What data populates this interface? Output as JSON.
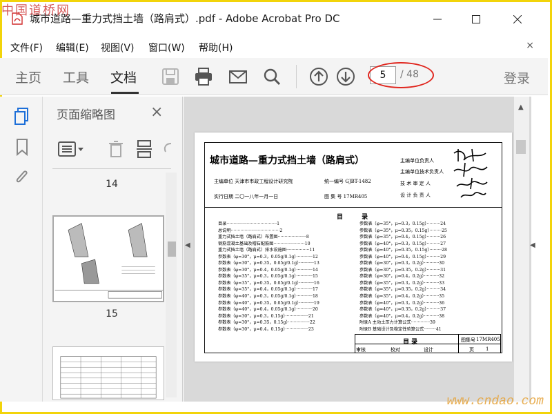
{
  "watermark_top": "中国道桥网",
  "watermark_bottom": "www.cndao.com",
  "window": {
    "title": "城市道路—重力式挡土墙（路肩式）.pdf - Adobe Acrobat Pro DC",
    "minimize_icon": "minimize-icon",
    "maximize_icon": "maximize-icon",
    "close_icon": "close-icon"
  },
  "menubar": {
    "items": [
      "文件(F)",
      "编辑(E)",
      "视图(V)",
      "窗口(W)",
      "帮助(H)"
    ],
    "close": "×"
  },
  "toolbar": {
    "tabs": [
      "主页",
      "工具",
      "文档"
    ],
    "active_tab": "文档",
    "icons": [
      "save-icon",
      "print-icon",
      "email-icon",
      "search-icon",
      "page-up-icon",
      "page-down-icon"
    ],
    "page_current": "5",
    "page_total": "/ 48",
    "login": "登录"
  },
  "left_rail": {
    "icons": [
      "page-thumbnails-icon",
      "bookmark-icon",
      "attachment-icon"
    ]
  },
  "thumbnail_panel": {
    "title": "页面缩略图",
    "close": "×",
    "tool_icons": [
      "options-menu-icon",
      "delete-icon",
      "insert-page-icon",
      "rotate-icon"
    ],
    "labels": [
      "14",
      "15"
    ]
  },
  "document": {
    "title": "城市道路—重力式挡土墙（路肩式）",
    "meta_left": [
      "主编单位  天津市市政工程设计研究院",
      "实行日期  二〇一八年一月一日"
    ],
    "meta_mid": [
      "统一编号  GJBT-1482",
      "图 集 号  17MR405"
    ],
    "meta_right": [
      "主编单位负责人",
      "主编单位技术负责人",
      "技 术 审 定 人",
      "设 计 负 责 人"
    ],
    "toc_heading": "目 录",
    "toc_left": [
      "目录·····································1",
      "总说明····································2",
      "重力式挡土墙（路肩式）布置图·····················8",
      "钢筋混凝土基础及帽石配筋图·······················10",
      "重力式挡土墙（路肩式）排水设施图·················11",
      "参数表（φ=30°，μ=0.3，0.05g/0.1g）············12",
      "参数表（φ=30°，μ=0.35，0.05g/0.1g）···········13",
      "参数表（φ=30°，μ=0.4，0.05g/0.1g）············14",
      "参数表（φ=35°，μ=0.3，0.05g/0.1g）············15",
      "参数表（φ=35°，μ=0.35，0.05g/0.1g）···········16",
      "参数表（φ=35°，μ=0.4，0.05g/0.1g）············17",
      "参数表（φ=40°，μ=0.3，0.05g/0.1g）············18",
      "参数表（φ=40°，μ=0.35，0.05g/0.1g）···········19",
      "参数表（φ=40°，μ=0.4，0.05g/0.1g）············20",
      "参数表（φ=30°，μ=0.3，0.15g）·················21",
      "参数表（φ=30°，μ=0.35，0.15g）················22",
      "参数表（φ=30°，μ=0.4，0.15g）·················23"
    ],
    "toc_right": [
      "参数表（φ=35°，μ=0.3，0.15g）··········24",
      "参数表（φ=35°，μ=0.35，0.15g）·········25",
      "参数表（φ=35°，μ=0.4，0.15g）··········26",
      "参数表（φ=40°，μ=0.3，0.15g）··········27",
      "参数表（φ=40°，μ=0.35，0.15g）·········28",
      "参数表（φ=40°，μ=0.4，0.15g）··········29",
      "参数表（φ=30°，μ=0.3，0.2g）···········30",
      "参数表（φ=30°，μ=0.35，0.2g）··········31",
      "参数表（φ=30°，μ=0.4，0.2g）···········32",
      "参数表（φ=35°，μ=0.3，0.2g）···········33",
      "参数表（φ=35°，μ=0.35，0.2g）··········34",
      "参数表（φ=35°，μ=0.4，0.2g）···········35",
      "参数表（φ=40°，μ=0.3，0.2g）···········36",
      "参数表（φ=40°，μ=0.35，0.2g）··········37",
      "参数表（φ=40°，μ=0.4，0.2g）···········38",
      "附录A  主动土压力计算公式··············39",
      "附录B  基础设计及稳定性验算公式·········41"
    ],
    "titleblock_name": "目  录",
    "titleblock_set_label": "图集号",
    "titleblock_set": "17MR405",
    "titleblock_row": [
      "审核",
      "校对",
      "设计",
      "页",
      "1"
    ],
    "titleblock_page_label": "页"
  },
  "colors": {
    "accent_blue": "#1d6fd8",
    "annotation_red": "#e0261e",
    "frame_yellow": "#f2d40a"
  }
}
